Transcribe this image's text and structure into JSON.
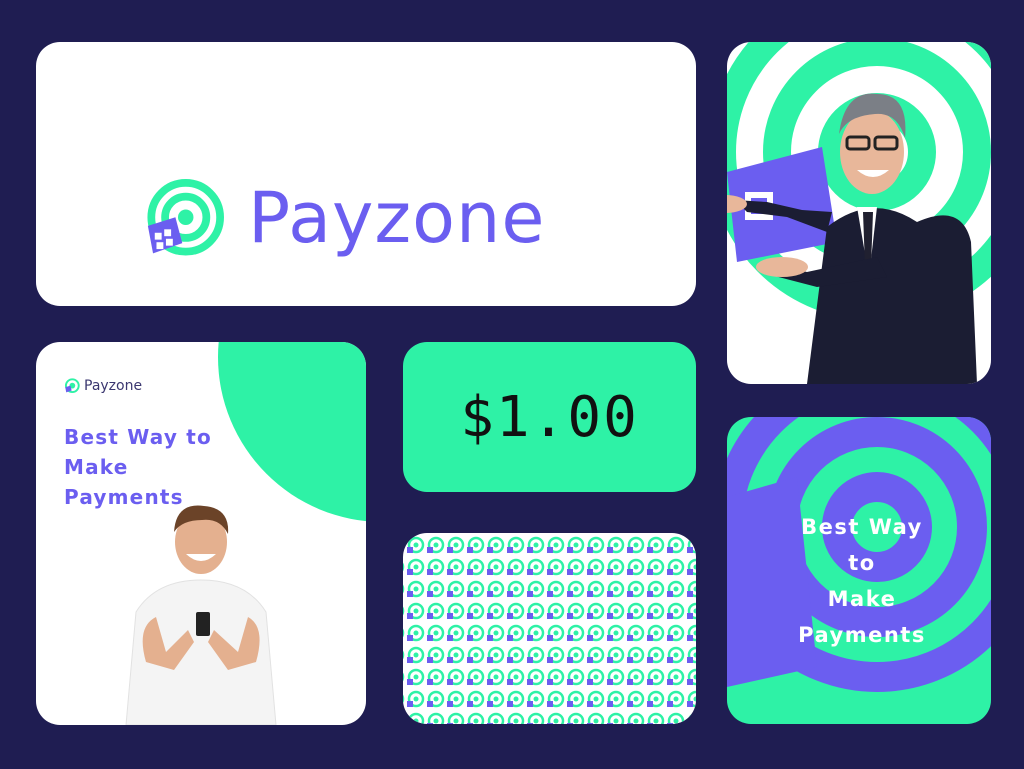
{
  "brand": {
    "name": "Payzone",
    "colors": {
      "background": "#1f1d52",
      "accent_green": "#2ef2a6",
      "accent_purple": "#6b5ef0",
      "white": "#ffffff"
    }
  },
  "logo_card": {
    "wordmark": "Payzone",
    "icon": "payzone-logo-icon"
  },
  "promo_card": {
    "mini_wordmark": "Payzone",
    "tagline_lines": [
      "Best Way to",
      "Make",
      "Payments"
    ],
    "photo": "smiling-man-with-phone"
  },
  "price_card": {
    "price": "$1.00"
  },
  "pattern_card": {
    "icon": "payzone-logo-pattern"
  },
  "man_card": {
    "photo": "businessman-presenting"
  },
  "promo2_card": {
    "tagline_lines": [
      "Best Way",
      "to",
      "Make",
      "Payments"
    ]
  }
}
